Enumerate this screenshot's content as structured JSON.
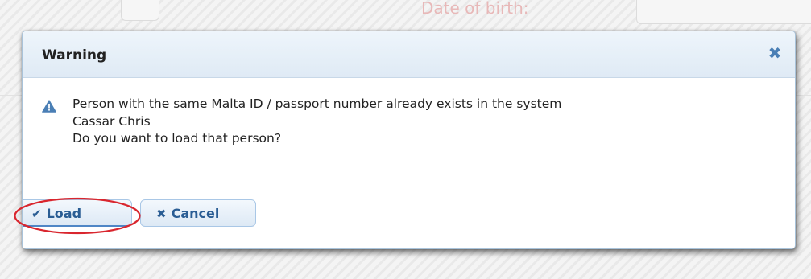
{
  "background": {
    "partial_label": "Date of birth:"
  },
  "dialog": {
    "title": "Warning",
    "close_icon": "close-icon",
    "message_lines": [
      "Person with the same Malta ID / passport number already exists in the system",
      "Cassar Chris",
      "Do you want to load that person?"
    ],
    "warning_icon": "warning-triangle-icon",
    "buttons": {
      "load_label": "Load",
      "load_icon": "checkmark-icon",
      "cancel_label": "Cancel",
      "cancel_icon": "x-icon"
    }
  },
  "colors": {
    "header_bg": "#dfeaf5",
    "button_text": "#2a5d94",
    "highlight_ring": "#d9262e"
  }
}
